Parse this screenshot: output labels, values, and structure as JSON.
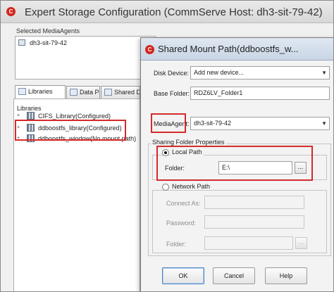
{
  "main_window": {
    "title": "Expert Storage Configuration (CommServe Host: dh3-sit-79-42)",
    "selected_mediaagents_label": "Selected MediaAgents",
    "selected_mediaagents": [
      "dh3-sit-79-42"
    ],
    "tabs": [
      {
        "label": "Libraries",
        "icon": "library-icon"
      },
      {
        "label": "Data Paths",
        "icon": "data-paths-icon"
      },
      {
        "label": "Shared D",
        "icon": "shared-disk-icon"
      }
    ],
    "tree": {
      "root_label": "Libraries",
      "items": [
        {
          "label": "CIFS_Library(Configured)",
          "expander": "+"
        },
        {
          "label": "ddboostfs_library(Configured)",
          "expander": "+"
        },
        {
          "label": "ddboostfs_window(No mount path)",
          "expander": "+"
        }
      ]
    }
  },
  "dialog": {
    "title": "Shared Mount Path(ddboostfs_w...",
    "disk_device": {
      "label": "Disk Device:",
      "value": "Add new device..."
    },
    "base_folder": {
      "label": "Base Folder:",
      "value": "RDZ6LV_Folder1"
    },
    "mediaagent": {
      "label": "MediaAgent:",
      "value": "dh3-sit-79-42"
    },
    "sharing_group": {
      "legend": "Sharing Folder Properties",
      "local_path": {
        "label": "Local Path",
        "selected": true,
        "folder_label": "Folder:",
        "folder_value": "E:\\",
        "browse": "..."
      },
      "network_path": {
        "label": "Network Path",
        "selected": false,
        "connect_as_label": "Connect As:",
        "connect_as_value": "",
        "password_label": "Password:",
        "password_value": "",
        "folder_label": "Folder:",
        "folder_value": "",
        "browse": "..."
      }
    },
    "buttons": {
      "ok": "OK",
      "cancel": "Cancel",
      "help": "Help"
    }
  },
  "colors": {
    "highlight_red": "#d42a2a",
    "logo_red": "#d3261e"
  }
}
